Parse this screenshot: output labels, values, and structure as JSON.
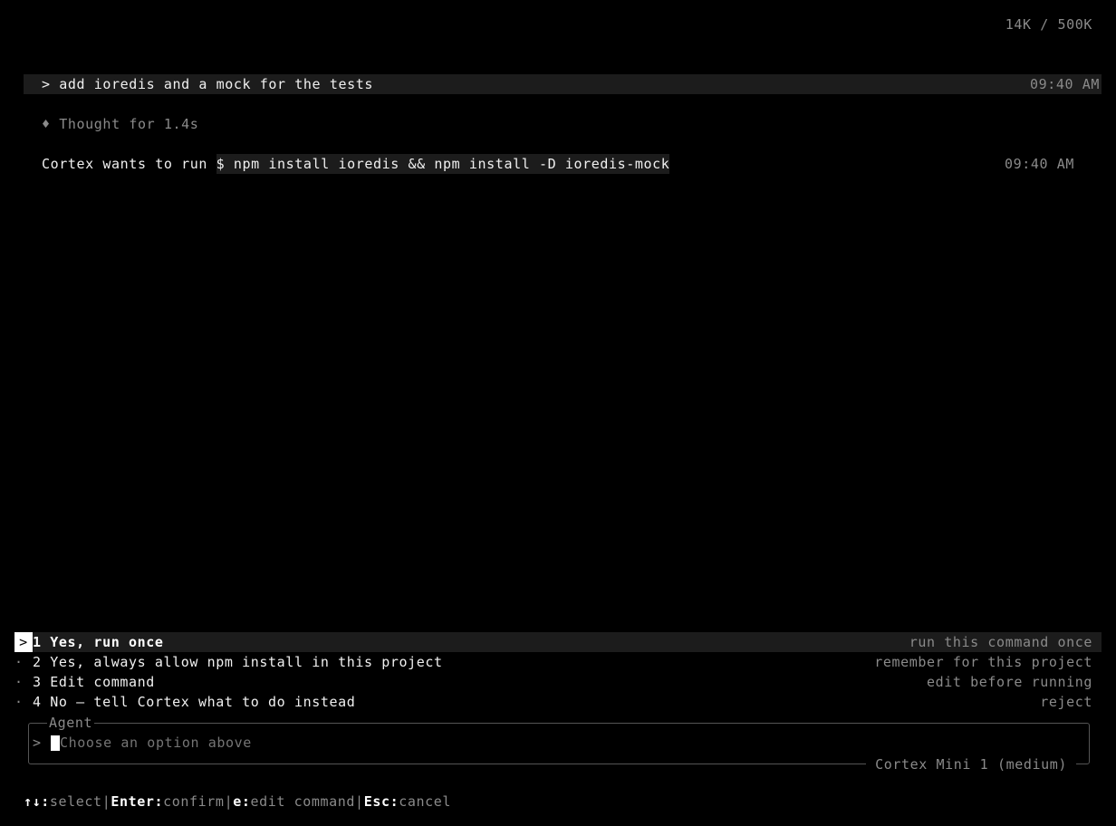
{
  "header": {
    "token_usage": "14K / 500K"
  },
  "conversation": {
    "user_message": {
      "text": "> add ioredis and a mock for the tests",
      "time": "09:40 AM"
    },
    "thought": {
      "icon": "diamond-icon",
      "glyph": "♦",
      "text": "Thought for 1.4s"
    },
    "permission_request": {
      "prefix": "Cortex wants to run ",
      "command": "$ npm install ioredis && npm install -D ioredis-mock",
      "time": "09:40 AM"
    }
  },
  "options": [
    {
      "marker": ">",
      "number": "1",
      "label": "Yes, run once",
      "hint": "run this command once",
      "selected": true
    },
    {
      "marker": "·",
      "number": "2",
      "label": "Yes, always allow npm install in this project",
      "hint": "remember for this project",
      "selected": false
    },
    {
      "marker": "·",
      "number": "3",
      "label": "Edit command",
      "hint": "edit before running",
      "selected": false
    },
    {
      "marker": "·",
      "number": "4",
      "label": "No — tell Cortex what to do instead",
      "hint": "reject",
      "selected": false
    }
  ],
  "agent_box": {
    "title": "Agent",
    "prompt": ">",
    "placeholder": "Choose an option above",
    "model": "Cortex Mini 1 (medium)"
  },
  "keybar": {
    "items": [
      {
        "key": "↑↓:",
        "action": "select"
      },
      {
        "key": "Enter:",
        "action": "confirm"
      },
      {
        "key": "e:",
        "action": "edit command"
      },
      {
        "key": "Esc:",
        "action": "cancel"
      }
    ],
    "separator": "|"
  },
  "colors": {
    "background": "#000000",
    "text": "#e6e6e6",
    "dim": "#8a8a8a",
    "highlight_row": "#1c1c1c"
  }
}
